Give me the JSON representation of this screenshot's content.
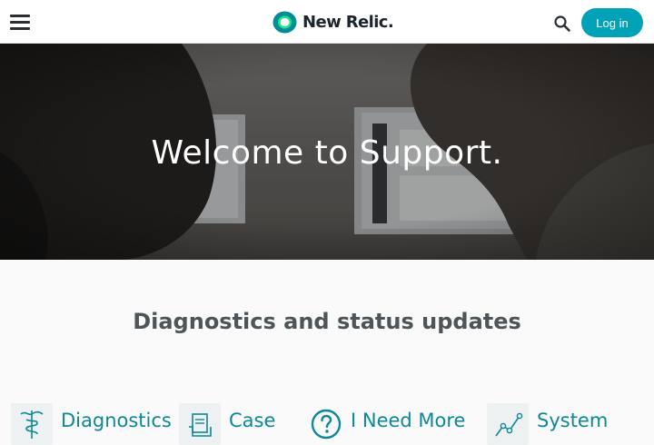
{
  "header": {
    "menu_icon": "hamburger-menu-icon",
    "logo_text": "New Relic.",
    "search_icon": "search-icon",
    "login_label": "Log in",
    "accent_color": "#00a2b8"
  },
  "hero": {
    "title": "Welcome to Support."
  },
  "section": {
    "title": "Diagnostics and status updates"
  },
  "cards": [
    {
      "label": "Diagnostics",
      "icon": "caduceus-icon"
    },
    {
      "label": "Case",
      "icon": "document-icon"
    },
    {
      "label": "I Need More",
      "icon": "question-icon"
    },
    {
      "label": "System",
      "icon": "line-chart-icon"
    }
  ]
}
